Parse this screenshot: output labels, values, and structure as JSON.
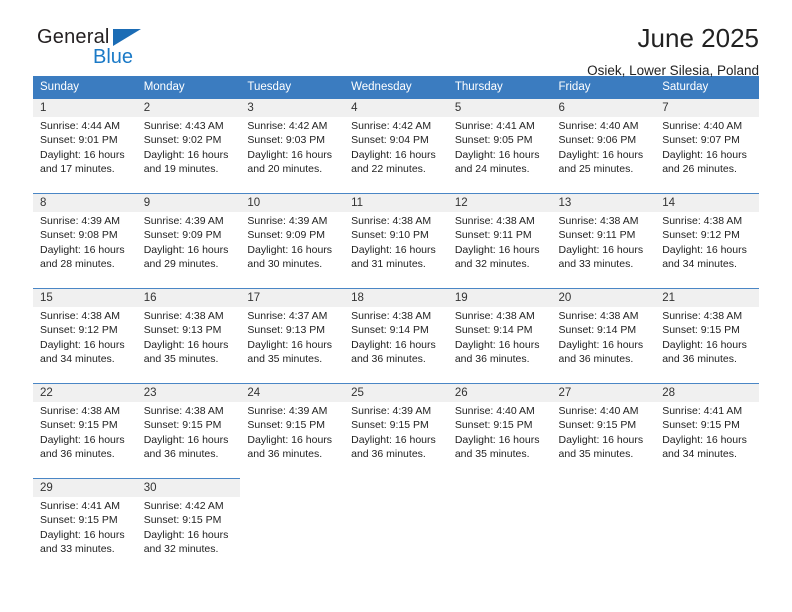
{
  "brand": {
    "name_top": "General",
    "name_bottom": "Blue"
  },
  "header": {
    "title": "June 2025",
    "location": "Osiek, Lower Silesia, Poland"
  },
  "colors": {
    "header_blue": "#3b7cc0",
    "row_divider_blue": "#4a86c5",
    "daynum_background": "#f0f0f0",
    "logo_blue": "#1b7ac7",
    "text": "#222222"
  },
  "calendar": {
    "weekday_headers": [
      "Sunday",
      "Monday",
      "Tuesday",
      "Wednesday",
      "Thursday",
      "Friday",
      "Saturday"
    ],
    "weeks": [
      [
        {
          "day": "1",
          "sunrise": "Sunrise: 4:44 AM",
          "sunset": "Sunset: 9:01 PM",
          "daylight_1": "Daylight: 16 hours",
          "daylight_2": "and 17 minutes."
        },
        {
          "day": "2",
          "sunrise": "Sunrise: 4:43 AM",
          "sunset": "Sunset: 9:02 PM",
          "daylight_1": "Daylight: 16 hours",
          "daylight_2": "and 19 minutes."
        },
        {
          "day": "3",
          "sunrise": "Sunrise: 4:42 AM",
          "sunset": "Sunset: 9:03 PM",
          "daylight_1": "Daylight: 16 hours",
          "daylight_2": "and 20 minutes."
        },
        {
          "day": "4",
          "sunrise": "Sunrise: 4:42 AM",
          "sunset": "Sunset: 9:04 PM",
          "daylight_1": "Daylight: 16 hours",
          "daylight_2": "and 22 minutes."
        },
        {
          "day": "5",
          "sunrise": "Sunrise: 4:41 AM",
          "sunset": "Sunset: 9:05 PM",
          "daylight_1": "Daylight: 16 hours",
          "daylight_2": "and 24 minutes."
        },
        {
          "day": "6",
          "sunrise": "Sunrise: 4:40 AM",
          "sunset": "Sunset: 9:06 PM",
          "daylight_1": "Daylight: 16 hours",
          "daylight_2": "and 25 minutes."
        },
        {
          "day": "7",
          "sunrise": "Sunrise: 4:40 AM",
          "sunset": "Sunset: 9:07 PM",
          "daylight_1": "Daylight: 16 hours",
          "daylight_2": "and 26 minutes."
        }
      ],
      [
        {
          "day": "8",
          "sunrise": "Sunrise: 4:39 AM",
          "sunset": "Sunset: 9:08 PM",
          "daylight_1": "Daylight: 16 hours",
          "daylight_2": "and 28 minutes."
        },
        {
          "day": "9",
          "sunrise": "Sunrise: 4:39 AM",
          "sunset": "Sunset: 9:09 PM",
          "daylight_1": "Daylight: 16 hours",
          "daylight_2": "and 29 minutes."
        },
        {
          "day": "10",
          "sunrise": "Sunrise: 4:39 AM",
          "sunset": "Sunset: 9:09 PM",
          "daylight_1": "Daylight: 16 hours",
          "daylight_2": "and 30 minutes."
        },
        {
          "day": "11",
          "sunrise": "Sunrise: 4:38 AM",
          "sunset": "Sunset: 9:10 PM",
          "daylight_1": "Daylight: 16 hours",
          "daylight_2": "and 31 minutes."
        },
        {
          "day": "12",
          "sunrise": "Sunrise: 4:38 AM",
          "sunset": "Sunset: 9:11 PM",
          "daylight_1": "Daylight: 16 hours",
          "daylight_2": "and 32 minutes."
        },
        {
          "day": "13",
          "sunrise": "Sunrise: 4:38 AM",
          "sunset": "Sunset: 9:11 PM",
          "daylight_1": "Daylight: 16 hours",
          "daylight_2": "and 33 minutes."
        },
        {
          "day": "14",
          "sunrise": "Sunrise: 4:38 AM",
          "sunset": "Sunset: 9:12 PM",
          "daylight_1": "Daylight: 16 hours",
          "daylight_2": "and 34 minutes."
        }
      ],
      [
        {
          "day": "15",
          "sunrise": "Sunrise: 4:38 AM",
          "sunset": "Sunset: 9:12 PM",
          "daylight_1": "Daylight: 16 hours",
          "daylight_2": "and 34 minutes."
        },
        {
          "day": "16",
          "sunrise": "Sunrise: 4:38 AM",
          "sunset": "Sunset: 9:13 PM",
          "daylight_1": "Daylight: 16 hours",
          "daylight_2": "and 35 minutes."
        },
        {
          "day": "17",
          "sunrise": "Sunrise: 4:37 AM",
          "sunset": "Sunset: 9:13 PM",
          "daylight_1": "Daylight: 16 hours",
          "daylight_2": "and 35 minutes."
        },
        {
          "day": "18",
          "sunrise": "Sunrise: 4:38 AM",
          "sunset": "Sunset: 9:14 PM",
          "daylight_1": "Daylight: 16 hours",
          "daylight_2": "and 36 minutes."
        },
        {
          "day": "19",
          "sunrise": "Sunrise: 4:38 AM",
          "sunset": "Sunset: 9:14 PM",
          "daylight_1": "Daylight: 16 hours",
          "daylight_2": "and 36 minutes."
        },
        {
          "day": "20",
          "sunrise": "Sunrise: 4:38 AM",
          "sunset": "Sunset: 9:14 PM",
          "daylight_1": "Daylight: 16 hours",
          "daylight_2": "and 36 minutes."
        },
        {
          "day": "21",
          "sunrise": "Sunrise: 4:38 AM",
          "sunset": "Sunset: 9:15 PM",
          "daylight_1": "Daylight: 16 hours",
          "daylight_2": "and 36 minutes."
        }
      ],
      [
        {
          "day": "22",
          "sunrise": "Sunrise: 4:38 AM",
          "sunset": "Sunset: 9:15 PM",
          "daylight_1": "Daylight: 16 hours",
          "daylight_2": "and 36 minutes."
        },
        {
          "day": "23",
          "sunrise": "Sunrise: 4:38 AM",
          "sunset": "Sunset: 9:15 PM",
          "daylight_1": "Daylight: 16 hours",
          "daylight_2": "and 36 minutes."
        },
        {
          "day": "24",
          "sunrise": "Sunrise: 4:39 AM",
          "sunset": "Sunset: 9:15 PM",
          "daylight_1": "Daylight: 16 hours",
          "daylight_2": "and 36 minutes."
        },
        {
          "day": "25",
          "sunrise": "Sunrise: 4:39 AM",
          "sunset": "Sunset: 9:15 PM",
          "daylight_1": "Daylight: 16 hours",
          "daylight_2": "and 36 minutes."
        },
        {
          "day": "26",
          "sunrise": "Sunrise: 4:40 AM",
          "sunset": "Sunset: 9:15 PM",
          "daylight_1": "Daylight: 16 hours",
          "daylight_2": "and 35 minutes."
        },
        {
          "day": "27",
          "sunrise": "Sunrise: 4:40 AM",
          "sunset": "Sunset: 9:15 PM",
          "daylight_1": "Daylight: 16 hours",
          "daylight_2": "and 35 minutes."
        },
        {
          "day": "28",
          "sunrise": "Sunrise: 4:41 AM",
          "sunset": "Sunset: 9:15 PM",
          "daylight_1": "Daylight: 16 hours",
          "daylight_2": "and 34 minutes."
        }
      ],
      [
        {
          "day": "29",
          "sunrise": "Sunrise: 4:41 AM",
          "sunset": "Sunset: 9:15 PM",
          "daylight_1": "Daylight: 16 hours",
          "daylight_2": "and 33 minutes."
        },
        {
          "day": "30",
          "sunrise": "Sunrise: 4:42 AM",
          "sunset": "Sunset: 9:15 PM",
          "daylight_1": "Daylight: 16 hours",
          "daylight_2": "and 32 minutes."
        },
        {
          "day": "",
          "sunrise": "",
          "sunset": "",
          "daylight_1": "",
          "daylight_2": ""
        },
        {
          "day": "",
          "sunrise": "",
          "sunset": "",
          "daylight_1": "",
          "daylight_2": ""
        },
        {
          "day": "",
          "sunrise": "",
          "sunset": "",
          "daylight_1": "",
          "daylight_2": ""
        },
        {
          "day": "",
          "sunrise": "",
          "sunset": "",
          "daylight_1": "",
          "daylight_2": ""
        },
        {
          "day": "",
          "sunrise": "",
          "sunset": "",
          "daylight_1": "",
          "daylight_2": ""
        }
      ]
    ]
  }
}
